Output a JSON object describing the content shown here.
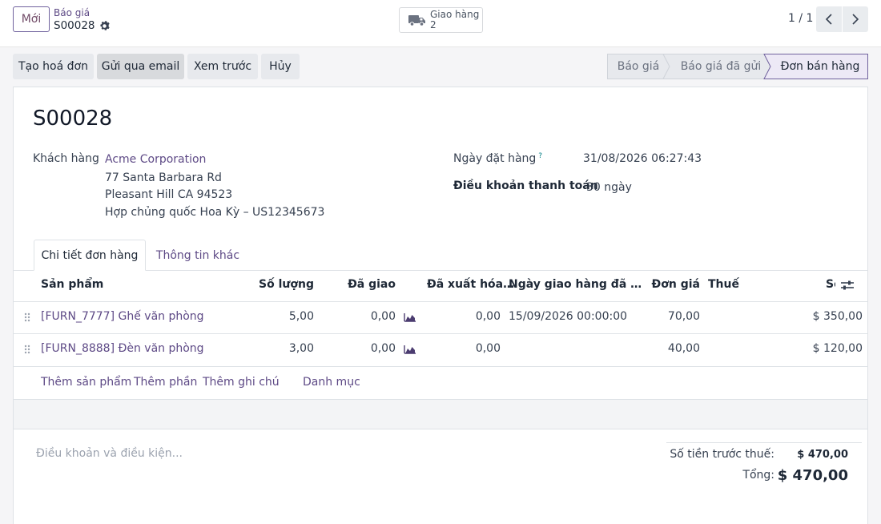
{
  "control_panel": {
    "new_button": "Mới",
    "breadcrumb_parent": "Báo giá",
    "breadcrumb_current": "S00028",
    "smart_button": {
      "label": "Giao hàng",
      "count": "2"
    },
    "pager": "1 / 1"
  },
  "actions": {
    "create_invoice": "Tạo hoá đơn",
    "send_email": "Gửi qua email",
    "preview": "Xem trước",
    "cancel": "Hủy"
  },
  "statusbar": {
    "stages": [
      "Báo giá",
      "Báo giá đã gửi",
      "Đơn bán hàng"
    ],
    "active": "Đơn bán hàng"
  },
  "record": {
    "name": "S00028",
    "customer_label": "Khách hàng",
    "customer_name": "Acme Corporation",
    "address_line1": "77 Santa Barbara Rd",
    "address_line2": "Pleasant Hill CA 94523",
    "address_line3": "Hợp chủng quốc Hoa Kỳ – US12345673",
    "order_date_label": "Ngày đặt hàng",
    "order_date_help": "?",
    "order_date": "31/08/2026 06:27:43",
    "payment_terms_label": "Điều khoản thanh toán",
    "payment_terms": "30 ngày"
  },
  "tabs": [
    "Chi tiết đơn hàng",
    "Thông tin khác"
  ],
  "table": {
    "headers": [
      "Sản phẩm",
      "Số lượng",
      "Đã giao",
      "Đã xuất hóa…",
      "Ngày giao hàng đã …",
      "Đơn giá",
      "Thuế",
      "Sc"
    ],
    "rows": [
      {
        "product": "[FURN_7777] Ghế văn phòng",
        "qty": "5,00",
        "delivered": "0,00",
        "invoiced": "0,00",
        "delivery_date": "15/09/2026 00:00:00",
        "unit_price": "70,00",
        "tax": "",
        "subtotal": "$ 350,00"
      },
      {
        "product": "[FURN_8888] Đèn văn phòng",
        "qty": "3,00",
        "delivered": "0,00",
        "invoiced": "0,00",
        "delivery_date": "",
        "unit_price": "40,00",
        "tax": "",
        "subtotal": "$ 120,00"
      }
    ],
    "add_links": [
      "Thêm sản phẩm",
      "Thêm phần",
      "Thêm ghi chú",
      "Danh mục"
    ]
  },
  "footer": {
    "terms_placeholder": "Điều khoản và điều kiện...",
    "untaxed_label": "Số tiền trước thuế:",
    "untaxed_value": "$ 470,00",
    "total_label": "Tổng:",
    "total_value": "$ 470,00"
  },
  "colors": {
    "brand": "#714b67",
    "link": "#5e4a86",
    "active_stage": "#ede9f6"
  },
  "icons": {
    "settings": "gear-icon",
    "delivery": "truck-icon",
    "forecast": "area-chart-icon",
    "optional_columns": "sliders-icon",
    "drag": "drag-handle-icon"
  }
}
